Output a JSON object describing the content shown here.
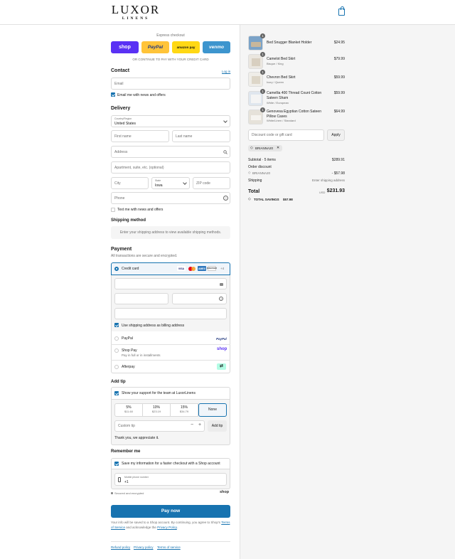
{
  "brand": {
    "name": "LUXOR",
    "sub": "LINENS"
  },
  "express": {
    "title": "Express checkout",
    "shop": "shop",
    "paypal": "PayPal",
    "amazon": "amazon pay",
    "venmo": "venmo",
    "or": "OR CONTINUE TO PAY WITH YOUR CREDIT CARD"
  },
  "contact": {
    "title": "Contact",
    "login": "Log in",
    "email_ph": "Email",
    "news": "Email me with news and offers"
  },
  "delivery": {
    "title": "Delivery",
    "country_label": "Country/Region",
    "country": "United States",
    "first_ph": "First name",
    "last_ph": "Last name",
    "address_ph": "Address",
    "apt_ph": "Apartment, suite, etc. (optional)",
    "city_ph": "City",
    "state_label": "State",
    "state": "Iowa",
    "zip_ph": "ZIP code",
    "phone_ph": "Phone",
    "text_news": "Text me with news and offers"
  },
  "shipping": {
    "title": "Shipping method",
    "placeholder": "Enter your shipping address to view available shipping methods."
  },
  "payment": {
    "title": "Payment",
    "subtitle": "All transactions are secure and encrypted.",
    "credit": "Credit card",
    "more": "+4",
    "billing": "Use shipping address as billing address",
    "paypal": "PayPal",
    "paypal_logo": "PayPal",
    "shoppay": "Shop Pay",
    "shoppay_sub": "Pay in full or in installments",
    "shoppay_logo": "shop",
    "afterpay": "Afterpay",
    "cards": [
      "VISA",
      "MC",
      "AMEX",
      "DISCOVER"
    ]
  },
  "tip": {
    "title": "Add tip",
    "support": "Show your support for the team at LuxorLinens",
    "options": [
      {
        "pct": "5%",
        "amt": "$11.60"
      },
      {
        "pct": "10%",
        "amt": "$23.19"
      },
      {
        "pct": "15%",
        "amt": "$34.79"
      }
    ],
    "none": "None",
    "custom_ph": "Custom tip",
    "add": "Add tip",
    "thanks": "Thank you, we appreciate it."
  },
  "remember": {
    "title": "Remember me",
    "save": "Save my information for a faster checkout with a Shop account",
    "mobile_label": "Mobile phone number",
    "mobile": "+1",
    "secure": "Secured and encrypted",
    "shop": "shop"
  },
  "pay": {
    "button": "Pay now",
    "terms_pre": "Your info will be saved to a Shop account. By continuing, you agree to Shop's",
    "terms_link": "Terms of Service",
    "terms_mid": "and acknowledge the",
    "privacy_link": "Privacy Policy",
    "terms_end": "."
  },
  "footer": {
    "links": [
      "Refund policy",
      "Privacy policy",
      "Terms of service"
    ]
  },
  "cart": {
    "items": [
      {
        "qty": "1",
        "name": "Bed Snugger Blanket Holder",
        "variant": "",
        "price": "$24.95"
      },
      {
        "qty": "1",
        "name": "Camelot Bed Skirt",
        "variant": "Bisque / King",
        "price": "$79.99"
      },
      {
        "qty": "1",
        "name": "Chevron Bed Skirt",
        "variant": "Ivory / Queen",
        "price": "$59.99"
      },
      {
        "qty": "1",
        "name": "Camellia 400 Thread Count Cotton Sateen Sham",
        "variant": "White / European",
        "price": "$59.99"
      },
      {
        "qty": "1",
        "name": "Genovesa Egyptian Cotton Sateen Pillow Cases",
        "variant": "White/Linen / Standard",
        "price": "$64.99"
      }
    ],
    "discount_ph": "Discount code or gift card",
    "apply": "Apply",
    "code": "BRIANNA20",
    "subtotal_label": "Subtotal · 5 items",
    "subtotal": "$289.91",
    "order_discount": "Order discount",
    "discount_code": "BRIANNA20",
    "discount_amt": "- $57.98",
    "shipping_label": "Shipping",
    "shipping_val": "Enter shipping address",
    "total_label": "Total",
    "currency": "USD",
    "total": "$231.93",
    "savings_label": "TOTAL SAVINGS",
    "savings": "$57.98"
  },
  "colors": {
    "accent": "#1773b0",
    "shop": "#5a31f4",
    "paypal": "#ffc439",
    "amazon": "#ffd814",
    "venmo": "#3d95ce"
  }
}
